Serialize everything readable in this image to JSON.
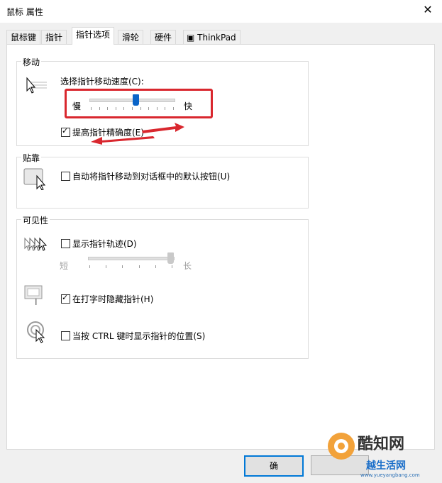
{
  "window": {
    "title": "鼠标 属性"
  },
  "tabs": [
    {
      "label": "鼠标键"
    },
    {
      "label": "指针"
    },
    {
      "label": "指针选项"
    },
    {
      "label": "滑轮"
    },
    {
      "label": "硬件"
    },
    {
      "label": "ThinkPad"
    }
  ],
  "motion": {
    "group_label": "移动",
    "speed_label": "选择指针移动速度(C):",
    "slow_label": "慢",
    "fast_label": "快",
    "speed_value_fraction": 0.55,
    "precision_label": "提高指针精确度(E)",
    "precision_checked": true
  },
  "snap": {
    "group_label": "贴靠",
    "snap_label": "自动将指针移动到对话框中的默认按钮(U)",
    "snap_checked": false
  },
  "visibility": {
    "group_label": "可见性",
    "trails_label": "显示指针轨迹(D)",
    "trails_checked": false,
    "short_label": "短",
    "long_label": "长",
    "trails_value_fraction": 1.0,
    "hide_label": "在打字时隐藏指针(H)",
    "hide_checked": true,
    "ctrl_label": "当按 CTRL 键时显示指针的位置(S)",
    "ctrl_checked": false
  },
  "footer": {
    "ok_label": "确",
    "watermark_text": "酷知网",
    "watermark_url": "www.yueyangbang.com",
    "watermark_text2": "越生活网"
  },
  "colors": {
    "annotation_red": "#d9272e",
    "slider_blue": "#0a64c8"
  }
}
